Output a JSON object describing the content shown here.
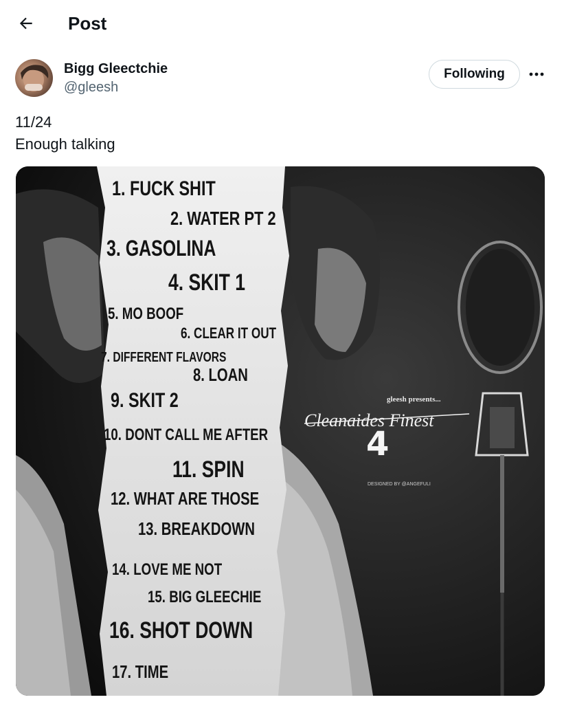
{
  "header": {
    "title": "Post",
    "back_icon": "arrow-left-icon"
  },
  "author": {
    "name": "Bigg Gleectchie",
    "handle": "@gleesh",
    "follow_label": "Following",
    "more_icon": "more-horizontal-icon"
  },
  "post": {
    "lines": [
      "11/24",
      "Enough talking"
    ]
  },
  "media": {
    "tracklist": [
      "1. FUCK SHIT",
      "2. WATER PT 2",
      "3. GASOLINA",
      "4. SKIT 1",
      "5. MO BOOF",
      "6. CLEAR IT OUT",
      "7. DIFFERENT FLAVORS",
      "8. LOAN",
      "9. SKIT 2",
      "10. DONT CALL ME AFTER",
      "11. SPIN",
      "12. WHAT ARE THOSE",
      "13. BREAKDOWN",
      "14. LOVE ME NOT",
      "15. BIG GLEECHIE",
      "16. SHOT DOWN",
      "17. TIME"
    ],
    "presenter": "gleesh presents...",
    "album_title": "Cleanaides Finest",
    "album_number": "4",
    "credit": "DESIGNED BY @ANGEFULI"
  }
}
